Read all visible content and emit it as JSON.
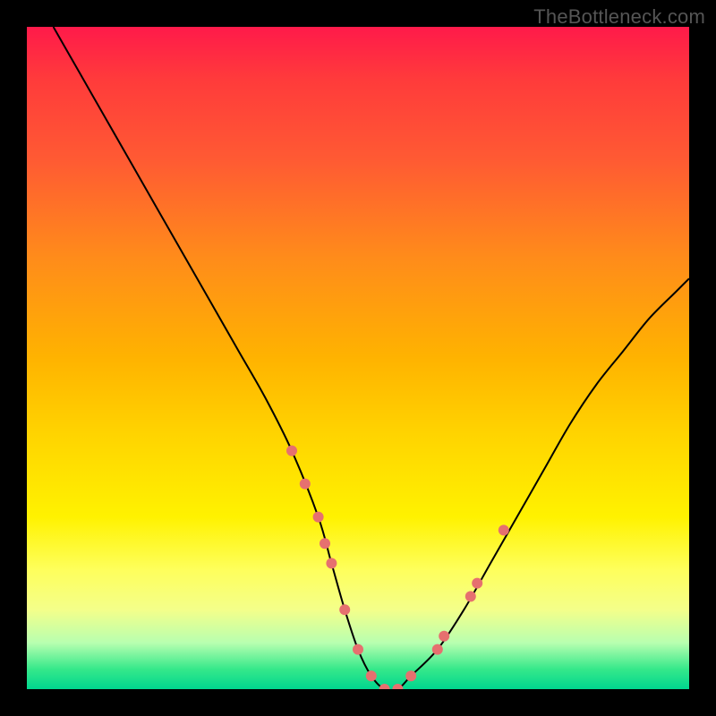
{
  "watermark": "TheBottleneck.com",
  "chart_data": {
    "type": "line",
    "title": "",
    "xlabel": "",
    "ylabel": "",
    "xlim": [
      0,
      100
    ],
    "ylim": [
      0,
      100
    ],
    "grid": false,
    "legend": false,
    "series": [
      {
        "name": "bottleneck-curve",
        "x": [
          4,
          8,
          12,
          16,
          20,
          24,
          28,
          32,
          36,
          40,
          44,
          46,
          48,
          50,
          52,
          54,
          56,
          58,
          62,
          66,
          70,
          74,
          78,
          82,
          86,
          90,
          94,
          98,
          100
        ],
        "y": [
          100,
          93,
          86,
          79,
          72,
          65,
          58,
          51,
          44,
          36,
          26,
          19,
          12,
          6,
          2,
          0,
          0,
          2,
          6,
          12,
          19,
          26,
          33,
          40,
          46,
          51,
          56,
          60,
          62
        ],
        "color": "#000000",
        "stroke_width": 2
      }
    ],
    "markers": {
      "name": "highlight-dots",
      "color": "#e6706f",
      "radius": 6,
      "points": [
        {
          "x": 40,
          "y": 36
        },
        {
          "x": 42,
          "y": 31
        },
        {
          "x": 44,
          "y": 26
        },
        {
          "x": 45,
          "y": 22
        },
        {
          "x": 46,
          "y": 19
        },
        {
          "x": 48,
          "y": 12
        },
        {
          "x": 50,
          "y": 6
        },
        {
          "x": 52,
          "y": 2
        },
        {
          "x": 54,
          "y": 0
        },
        {
          "x": 56,
          "y": 0
        },
        {
          "x": 58,
          "y": 2
        },
        {
          "x": 62,
          "y": 6
        },
        {
          "x": 63,
          "y": 8
        },
        {
          "x": 67,
          "y": 14
        },
        {
          "x": 68,
          "y": 16
        },
        {
          "x": 72,
          "y": 24
        }
      ]
    }
  }
}
